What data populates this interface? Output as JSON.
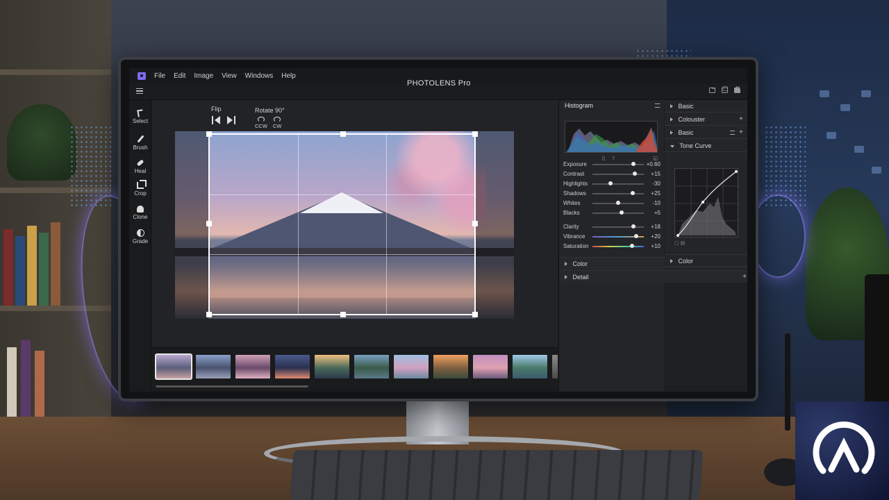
{
  "menu": {
    "items": [
      "File",
      "Edit",
      "Image",
      "View",
      "Windows",
      "Help"
    ]
  },
  "app": {
    "title": "PHOTOLENS Pro"
  },
  "tools": [
    {
      "label": "Select",
      "icon": "select-icon"
    },
    {
      "label": "Brush",
      "icon": "brush-icon"
    },
    {
      "label": "Heal",
      "icon": "heal-icon"
    },
    {
      "label": "Crop",
      "icon": "crop-icon"
    },
    {
      "label": "Clone",
      "icon": "clone-icon"
    },
    {
      "label": "Grade",
      "icon": "grade-icon"
    }
  ],
  "transform": {
    "flip_label": "Flip",
    "rotate_label": "Rotate 90°",
    "ccw_label": "CCW",
    "cw_label": "CW"
  },
  "panel_histogram": {
    "title": "Histogram"
  },
  "adjustments": [
    {
      "label": "Exposure",
      "value": "+0.60",
      "level": 0.8
    },
    {
      "label": "Contrast",
      "value": "+15",
      "level": 0.82
    },
    {
      "label": "Highlights",
      "value": "-30",
      "level": 0.35
    },
    {
      "label": "Shadows",
      "value": "+25",
      "level": 0.78
    },
    {
      "label": "Whites",
      "value": "-10",
      "level": 0.5
    },
    {
      "label": "Blacks",
      "value": "+5",
      "level": 0.57
    },
    {
      "label": "Clarity",
      "value": "+18",
      "level": 0.8
    },
    {
      "label": "Vibrance",
      "value": "+20",
      "level": 0.85
    },
    {
      "label": "Saturation",
      "value": "+10",
      "level": 0.77
    }
  ],
  "bottom_sections": [
    {
      "label": "Color"
    },
    {
      "label": "Detail"
    }
  ],
  "right_panel": {
    "basic1": "Basic",
    "colouster": "Colouster",
    "basic2": "Basic",
    "tone_curve": "Tone Curve",
    "color": "Color"
  },
  "colors": {
    "accent": "#7c6cf0",
    "panel_bg": "#242528",
    "canvas_bg": "#222326"
  },
  "filmstrip": {
    "count": 11,
    "selected_index": 0
  }
}
